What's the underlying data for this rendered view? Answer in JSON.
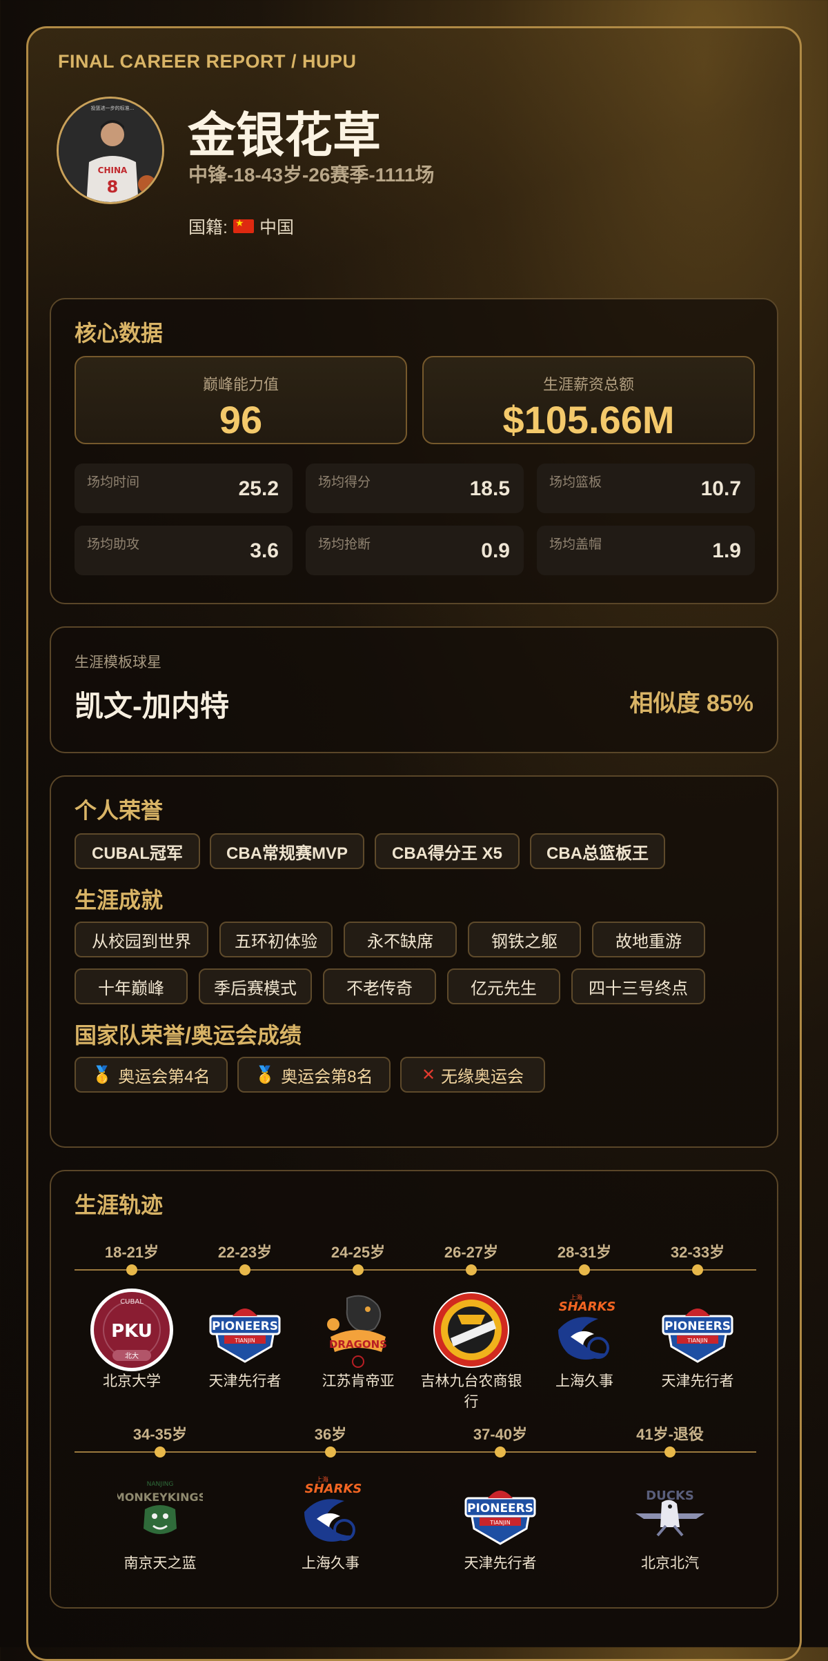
{
  "header": {
    "report_title": "FINAL CAREER REPORT / HUPU",
    "player_name": "金银花草",
    "player_sub": "中锋-18-43岁-26赛季-1111场",
    "nationality_label": "国籍:",
    "nationality_value": "中国",
    "avatar_caption": "投篮进一步的标准..."
  },
  "core": {
    "title": "核心数据",
    "peak_label": "巅峰能力值",
    "peak_value": "96",
    "salary_label": "生涯薪资总额",
    "salary_value": "$105.66M",
    "stats": [
      {
        "label": "场均时间",
        "value": "25.2"
      },
      {
        "label": "场均得分",
        "value": "18.5"
      },
      {
        "label": "场均篮板",
        "value": "10.7"
      },
      {
        "label": "场均助攻",
        "value": "3.6"
      },
      {
        "label": "场均抢断",
        "value": "0.9"
      },
      {
        "label": "场均盖帽",
        "value": "1.9"
      }
    ]
  },
  "template": {
    "label": "生涯模板球星",
    "player": "凯文-加内特",
    "similarity": "相似度 85%"
  },
  "honors": {
    "title": "个人荣誉",
    "items": [
      "CUBAL冠军",
      "CBA常规赛MVP",
      "CBA得分王 X5",
      "CBA总篮板王"
    ],
    "achievements_title": "生涯成就",
    "achievements": [
      "从校园到世界",
      "五环初体验",
      "永不缺席",
      "钢铁之躯",
      "故地重游",
      "十年巅峰",
      "季后赛模式",
      "不老传奇",
      "亿元先生",
      "四十三号终点"
    ],
    "national_title": "国家队荣誉/奥运会成绩",
    "national": [
      {
        "icon": "medal-icon",
        "text": "奥运会第4名"
      },
      {
        "icon": "medal-icon",
        "text": "奥运会第8名"
      },
      {
        "icon": "cross-icon",
        "text": "无缘奥运会"
      }
    ]
  },
  "career": {
    "title": "生涯轨迹",
    "row1": [
      {
        "age": "18-21岁",
        "team": "北京大学",
        "logo": "pku"
      },
      {
        "age": "22-23岁",
        "team": "天津先行者",
        "logo": "pioneers"
      },
      {
        "age": "24-25岁",
        "team": "江苏肯帝亚",
        "logo": "dragons"
      },
      {
        "age": "26-27岁",
        "team": "吉林九台农商银行",
        "logo": "jilin"
      },
      {
        "age": "28-31岁",
        "team": "上海久事",
        "logo": "sharks"
      },
      {
        "age": "32-33岁",
        "team": "天津先行者",
        "logo": "pioneers"
      }
    ],
    "row2": [
      {
        "age": "34-35岁",
        "team": "南京天之蓝",
        "logo": "monkeykings"
      },
      {
        "age": "36岁",
        "team": "上海久事",
        "logo": "sharks"
      },
      {
        "age": "37-40岁",
        "team": "天津先行者",
        "logo": "pioneers"
      },
      {
        "age": "41岁-退役",
        "team": "北京北汽",
        "logo": "ducks"
      }
    ],
    "logo_text": {
      "pku_top": "CUBAL",
      "pku_mid": "PKU",
      "pku_bottom": "北大",
      "pioneers": "PIONEERS",
      "pioneers_sub": "TIANJIN",
      "dragons": "DRAGONS",
      "sharks": "SHARKS",
      "sharks_top": "上海",
      "monkeykings": "MONKEYKINGS",
      "monkeykings_top": "NANJING",
      "ducks": "DUCKS"
    }
  }
}
